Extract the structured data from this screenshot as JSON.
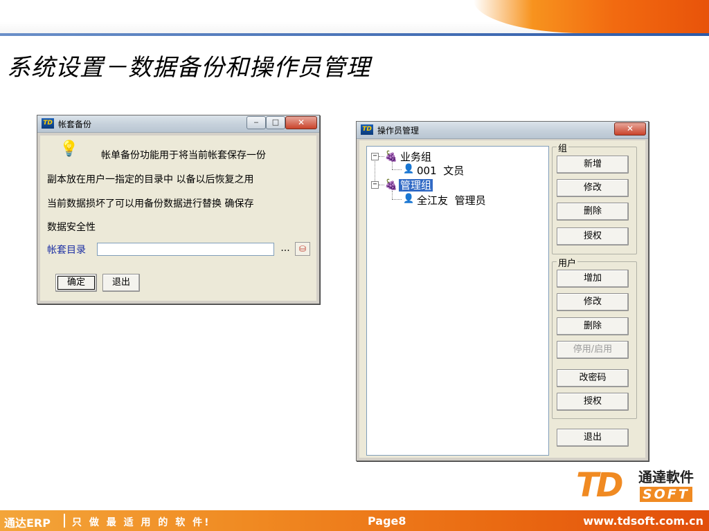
{
  "page": {
    "title": "系统设置－数据备份和操作员管理",
    "footer": {
      "brand": "通达ERP",
      "slogan": "只 做 最 适 用 的 软 件!",
      "page": "Page8",
      "url": "www.tdsoft.com.cn"
    },
    "logo": {
      "letters": "TD",
      "name": "通達軟件",
      "soft": "SOFT"
    }
  },
  "backup_window": {
    "title": "帐套备份",
    "icon": "app-td-icon",
    "message_lines": [
      "帐单备份功能用于将当前帐套保存一份",
      "副本放在用户一指定的目录中   以备以后恢复之用",
      "当前数据损坏了可以用备份数据进行替换    确保存",
      "数据安全性"
    ],
    "dir_label": "帐套目录",
    "dir_value": "",
    "browse_label": "...",
    "ok_label": "确定",
    "exit_label": "退出"
  },
  "operator_window": {
    "title": "操作员管理",
    "tree": {
      "groups": [
        {
          "name": "业务组",
          "users": [
            {
              "code": "001",
              "name": "文员"
            }
          ]
        },
        {
          "name": "管理组",
          "selected": true,
          "users": [
            {
              "code": "全江友",
              "name": "管理员"
            }
          ]
        }
      ]
    },
    "group_box": {
      "label": "组",
      "buttons": [
        "新增",
        "修改",
        "删除",
        "授权"
      ]
    },
    "user_box": {
      "label": "用户",
      "buttons": [
        "增加",
        "修改",
        "删除",
        "停用/启用",
        "改密码",
        "授权"
      ],
      "disabled_index": 3
    },
    "exit_label": "退出"
  },
  "colors": {
    "accent_orange": "#f08a22",
    "selection_blue": "#316ac5",
    "label_blue": "#1b2ea3"
  }
}
